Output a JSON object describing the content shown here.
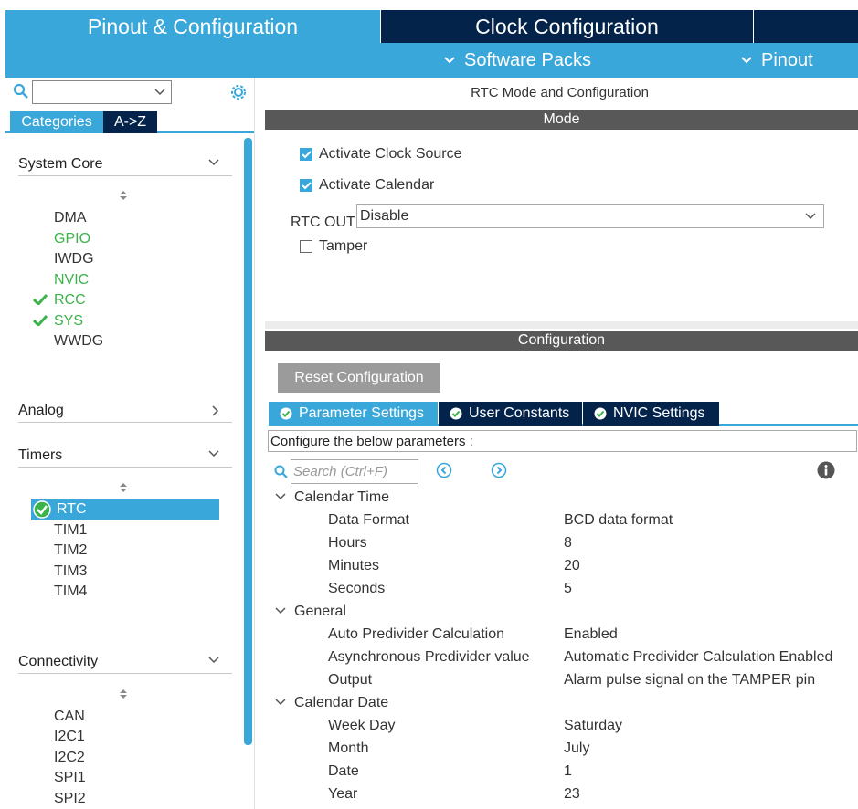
{
  "tabs": {
    "pinout_config": "Pinout & Configuration",
    "clock_config": "Clock Configuration"
  },
  "subnav": {
    "software_packs": "Software Packs",
    "pinout": "Pinout"
  },
  "left": {
    "category_tabs": [
      "Categories",
      "A->Z"
    ],
    "sections": {
      "system_core": "System Core",
      "analog": "Analog",
      "timers": "Timers",
      "connectivity": "Connectivity"
    },
    "system_core_items": [
      {
        "label": "DMA",
        "state": "normal"
      },
      {
        "label": "GPIO",
        "state": "green"
      },
      {
        "label": "IWDG",
        "state": "normal"
      },
      {
        "label": "NVIC",
        "state": "green"
      },
      {
        "label": "RCC",
        "state": "checked"
      },
      {
        "label": "SYS",
        "state": "checked"
      },
      {
        "label": "WWDG",
        "state": "normal"
      }
    ],
    "timers_items": [
      "RTC",
      "TIM1",
      "TIM2",
      "TIM3",
      "TIM4"
    ],
    "connectivity_items": [
      "CAN",
      "I2C1",
      "I2C2",
      "SPI1",
      "SPI2"
    ]
  },
  "right": {
    "title": "RTC Mode and Configuration",
    "mode_header": "Mode",
    "activate_clock_source": "Activate Clock Source",
    "activate_calendar": "Activate Calendar",
    "rtc_out_label": "RTC OUT",
    "rtc_out_value": "Disable",
    "tamper": "Tamper",
    "config_header": "Configuration",
    "reset_button": "Reset Configuration",
    "param_tabs": [
      "Parameter Settings",
      "User Constants",
      "NVIC Settings"
    ],
    "configure_text": "Configure the below parameters :",
    "search_placeholder": "Search (Ctrl+F)",
    "groups": {
      "calendar_time": "Calendar Time",
      "general": "General",
      "calendar_date": "Calendar Date"
    },
    "params": {
      "data_format": {
        "name": "Data Format",
        "value": "BCD data format"
      },
      "hours": {
        "name": "Hours",
        "value": "8"
      },
      "minutes": {
        "name": "Minutes",
        "value": "20"
      },
      "seconds": {
        "name": "Seconds",
        "value": "5"
      },
      "auto_predivider": {
        "name": "Auto Predivider Calculation",
        "value": "Enabled"
      },
      "async_predivider": {
        "name": "Asynchronous Predivider value",
        "value": "Automatic Predivider Calculation Enabled"
      },
      "output": {
        "name": "Output",
        "value": "Alarm pulse signal on the TAMPER pin"
      },
      "week_day": {
        "name": "Week Day",
        "value": "Saturday"
      },
      "month": {
        "name": "Month",
        "value": "July"
      },
      "date": {
        "name": "Date",
        "value": "1"
      },
      "year": {
        "name": "Year",
        "value": "23"
      }
    }
  },
  "colors": {
    "accent": "#3aa7da",
    "navy": "#03234b",
    "bar_gray": "#585858",
    "enabled_green": "#3cb24a"
  }
}
